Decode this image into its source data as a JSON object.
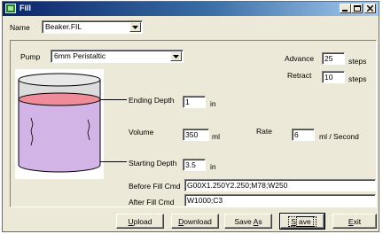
{
  "window": {
    "title": "Fill"
  },
  "name_field": {
    "label": "Name",
    "value": "Beaker.FIL"
  },
  "pump": {
    "label": "Pump",
    "value": "6mm Peristaltic"
  },
  "advance": {
    "label": "Advance",
    "value": "25",
    "unit": "steps"
  },
  "retract": {
    "label": "Retract",
    "value": "10",
    "unit": "steps"
  },
  "ending_depth": {
    "label": "Ending Depth",
    "value": "1",
    "unit": "in"
  },
  "volume": {
    "label": "Volume",
    "value": "350",
    "unit": "ml"
  },
  "rate": {
    "label": "Rate",
    "value": "6",
    "unit": "ml / Second"
  },
  "starting_depth": {
    "label": "Starting Depth",
    "value": "3.5",
    "unit": "in"
  },
  "before_fill": {
    "label": "Before Fill Cmd",
    "value": "G00X1.250Y2.250;M78;W250"
  },
  "after_fill": {
    "label": "After Fill Cmd",
    "value": "W1000;C3"
  },
  "buttons": {
    "upload": {
      "underline": "U",
      "rest": "pload"
    },
    "download": {
      "underline": "D",
      "rest": "ownload"
    },
    "saveas": {
      "pre": "Save ",
      "underline": "A",
      "rest": "s"
    },
    "save": {
      "underline": "S",
      "rest": "ave"
    },
    "exit": {
      "underline": "E",
      "rest": "xit"
    }
  },
  "colors": {
    "liquid_surface": "#f08c9a",
    "liquid_body": "#d2b4e6",
    "tank_top": "#dcdcdc",
    "titlebar": "#0a246a"
  },
  "icons": [
    "app-fill-icon",
    "minimize-icon",
    "maximize-icon",
    "close-icon",
    "dropdown-arrow-icon"
  ]
}
